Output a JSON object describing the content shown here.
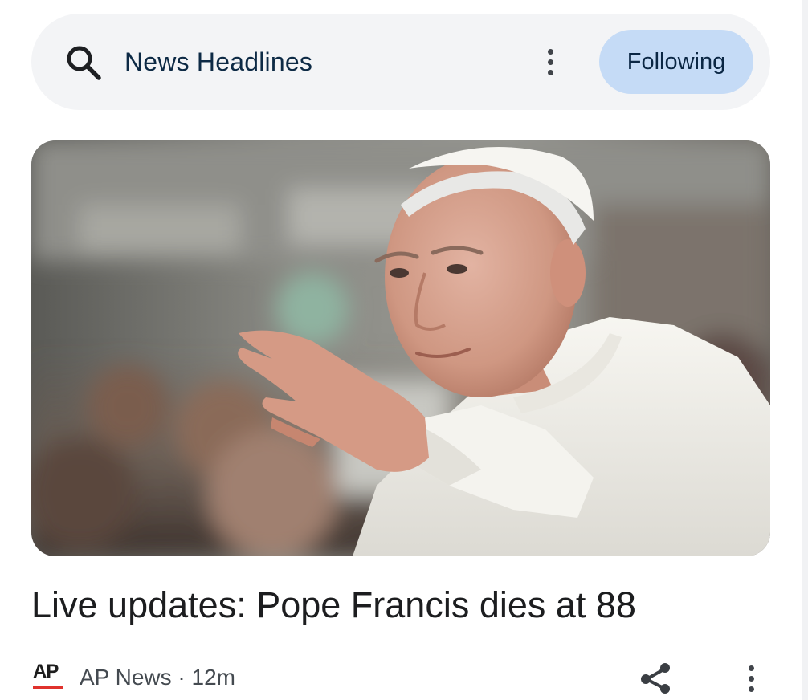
{
  "header": {
    "title": "News Headlines",
    "follow_label": "Following",
    "icons": {
      "search": "search-icon",
      "more": "more-vertical-icon"
    },
    "colors": {
      "pill_bg": "#f3f4f6",
      "follow_bg": "#c5dbf6",
      "title_color": "#0d2a45"
    }
  },
  "article": {
    "image_alt": "Pope Francis waving",
    "headline": "Live updates: Pope Francis dies at 88",
    "source": {
      "logo_text": "AP",
      "name": "AP News",
      "separator": "·",
      "age": "12m",
      "logo_accent": "#e0322d"
    },
    "icons": {
      "share": "share-icon",
      "more": "more-vertical-icon"
    }
  }
}
